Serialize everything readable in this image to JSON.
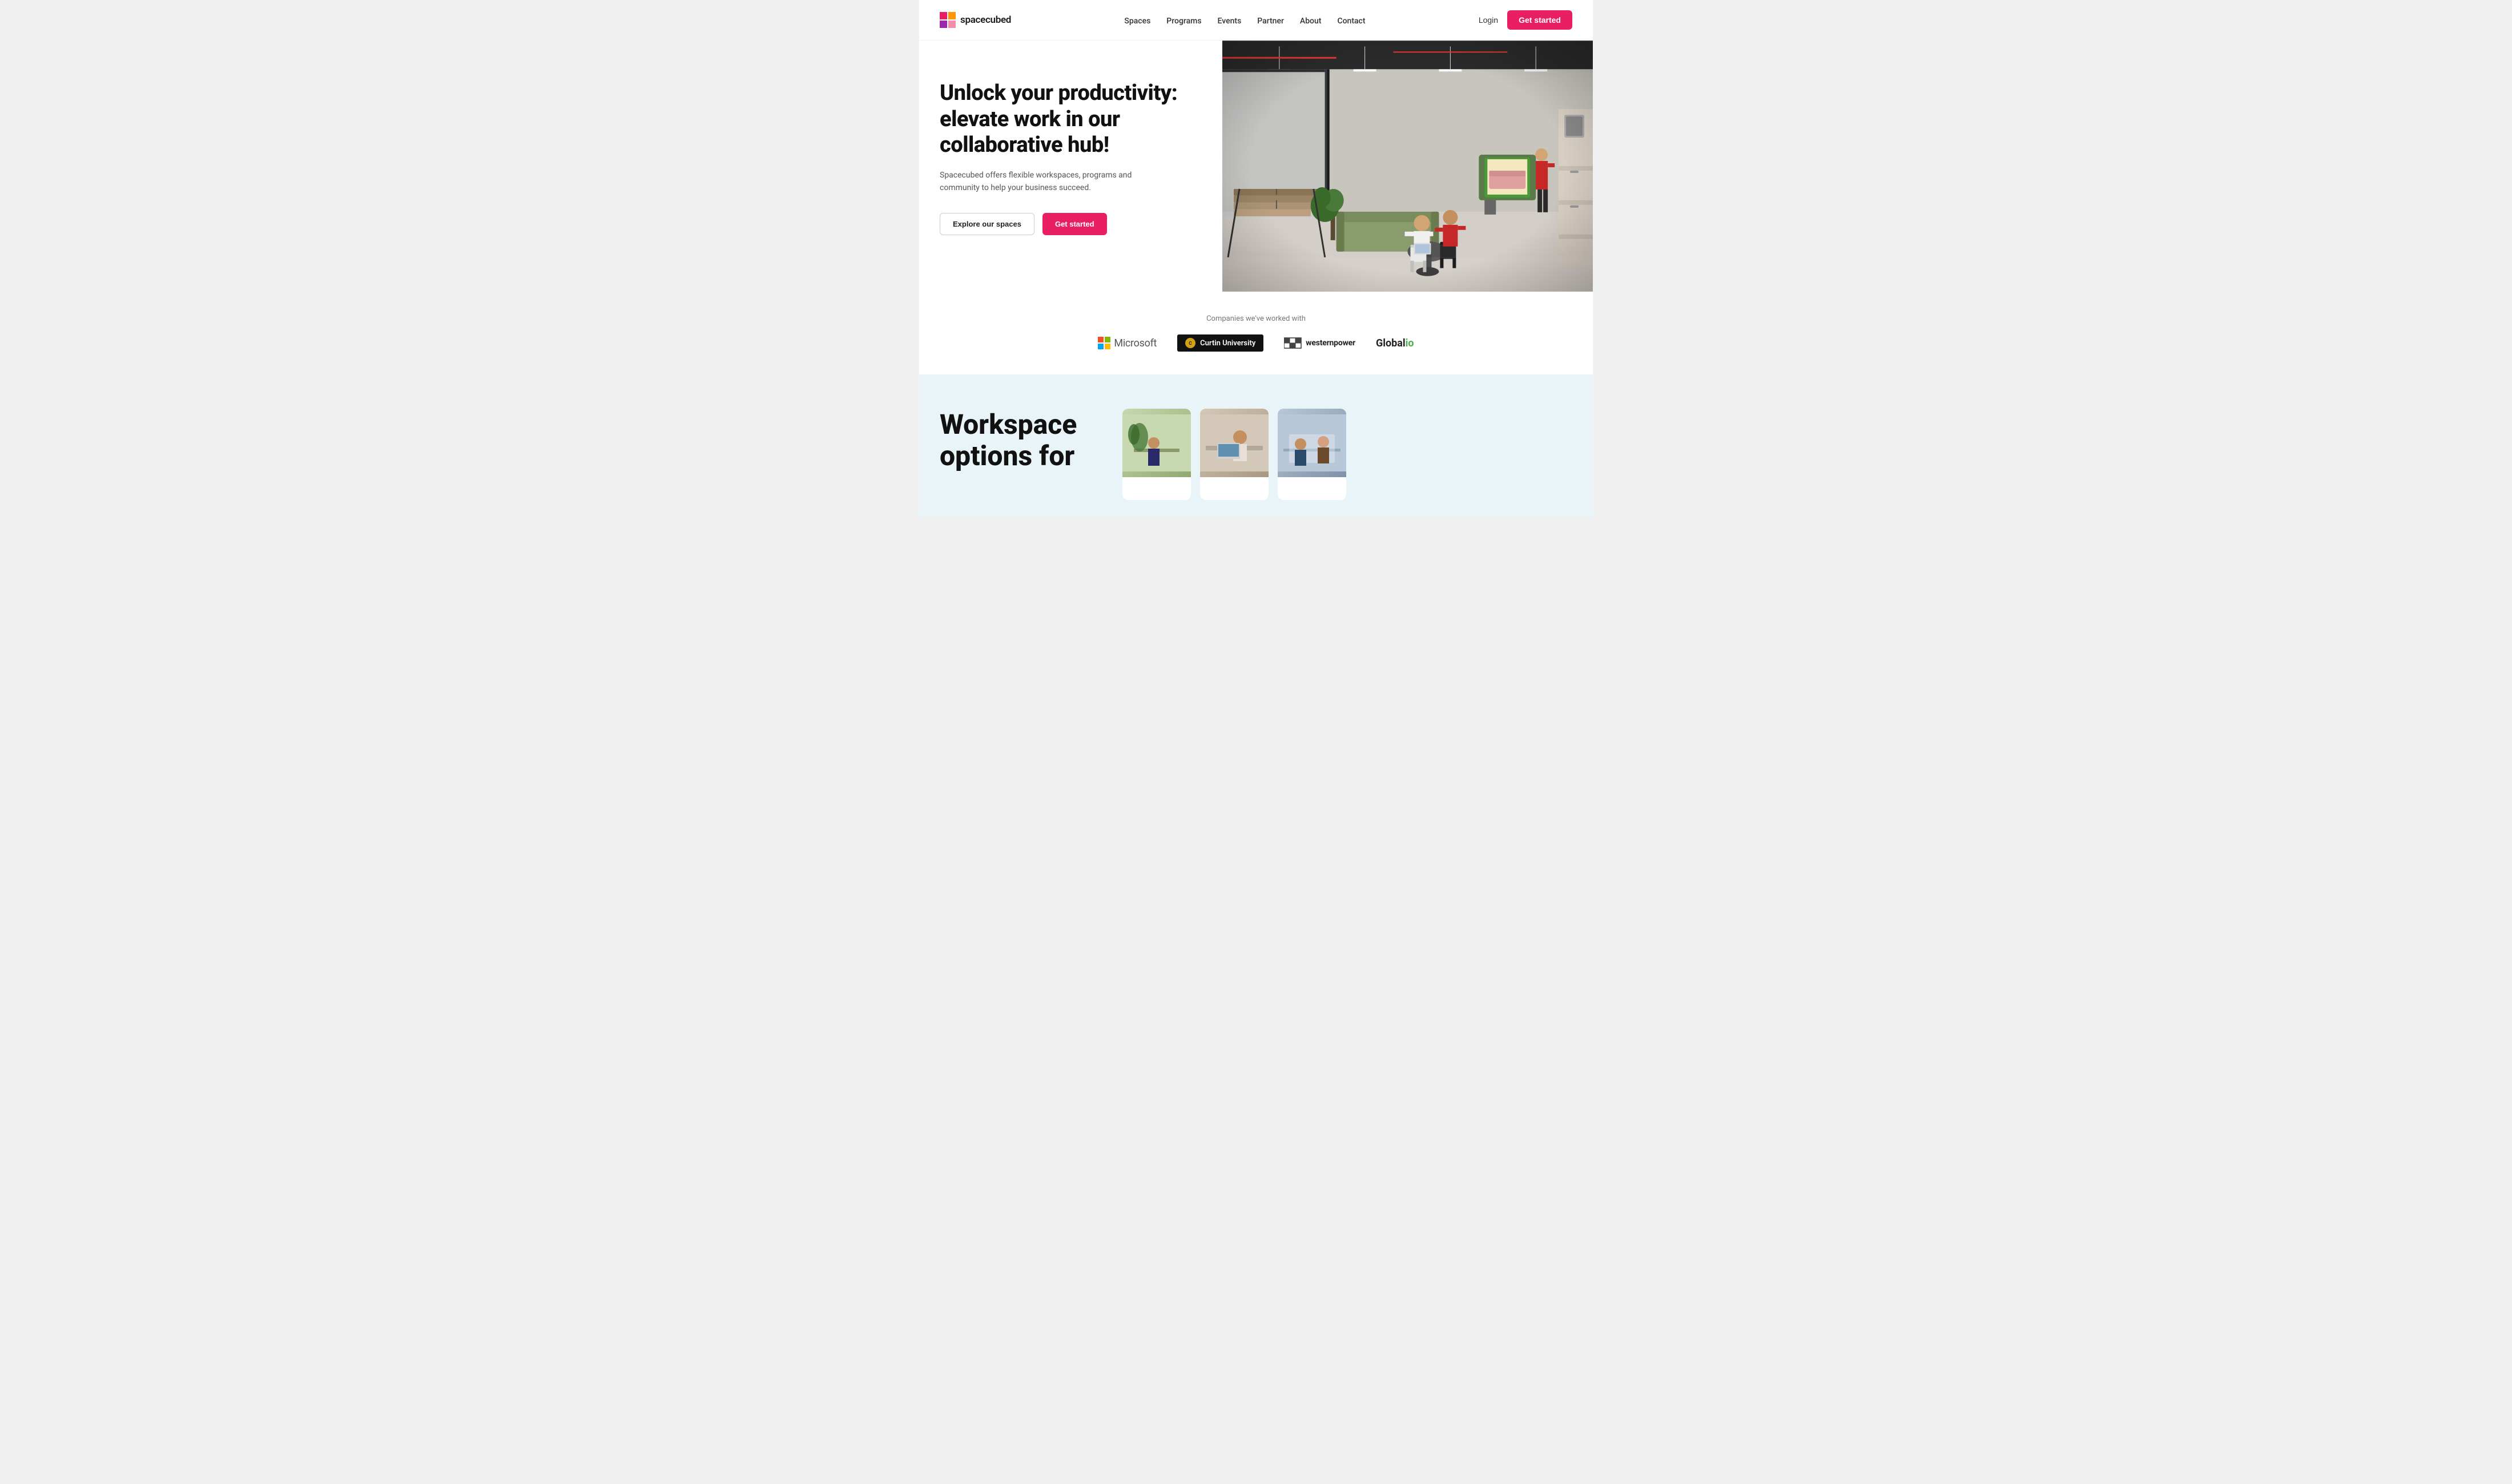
{
  "site": {
    "logo_text": "spacecubed",
    "logo_icon": "🟥"
  },
  "nav": {
    "links": [
      {
        "label": "Spaces",
        "href": "#"
      },
      {
        "label": "Programs",
        "href": "#"
      },
      {
        "label": "Events",
        "href": "#"
      },
      {
        "label": "Partner",
        "href": "#"
      },
      {
        "label": "About",
        "href": "#"
      },
      {
        "label": "Contact",
        "href": "#"
      }
    ],
    "login_label": "Login",
    "get_started_label": "Get started"
  },
  "hero": {
    "title": "Unlock your productivity: elevate work in our collaborative hub!",
    "subtitle": "Spacecubed offers flexible workspaces, programs and community to help your business succeed.",
    "btn_explore": "Explore our spaces",
    "btn_get_started": "Get started"
  },
  "partners": {
    "label": "Companies we've worked with",
    "logos": [
      {
        "name": "Microsoft",
        "type": "microsoft"
      },
      {
        "name": "Curtin University",
        "type": "curtin"
      },
      {
        "name": "westernpower",
        "type": "westernpower"
      },
      {
        "name": "Global io",
        "type": "globalio"
      }
    ]
  },
  "workspace": {
    "title_line1": "Workspace",
    "title_line2": "options for"
  }
}
